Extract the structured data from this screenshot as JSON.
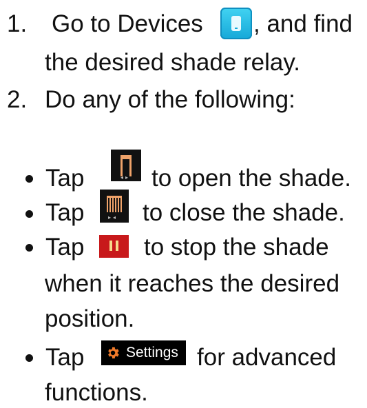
{
  "steps": [
    {
      "number": "1.",
      "before_icon": "Go to Devices",
      "after_icon": ", and find",
      "continuation": "the desired shade relay.",
      "icon": "devices-icon"
    },
    {
      "number": "2.",
      "text": "Do any of the following:"
    }
  ],
  "bullets": [
    {
      "prefix": "Tap",
      "text": "to open the shade.",
      "icon": "shade-open-icon"
    },
    {
      "prefix": "Tap",
      "text": "to close the shade.",
      "icon": "shade-close-icon"
    },
    {
      "prefix": "Tap",
      "text": "to stop the shade",
      "continuation_1": "when it reaches the desired",
      "continuation_2": "position.",
      "icon": "stop-icon"
    },
    {
      "prefix": "Tap",
      "text": "for advanced",
      "continuation_1": "functions.",
      "icon": "settings-gear-icon",
      "badge_label": "Settings"
    }
  ],
  "colors": {
    "devices_icon": "#1fb3e0",
    "shade_accent": "#f0a36a",
    "stop_icon": "#c8191b",
    "settings_badge": "#000000",
    "gear": "#f07a2a"
  }
}
